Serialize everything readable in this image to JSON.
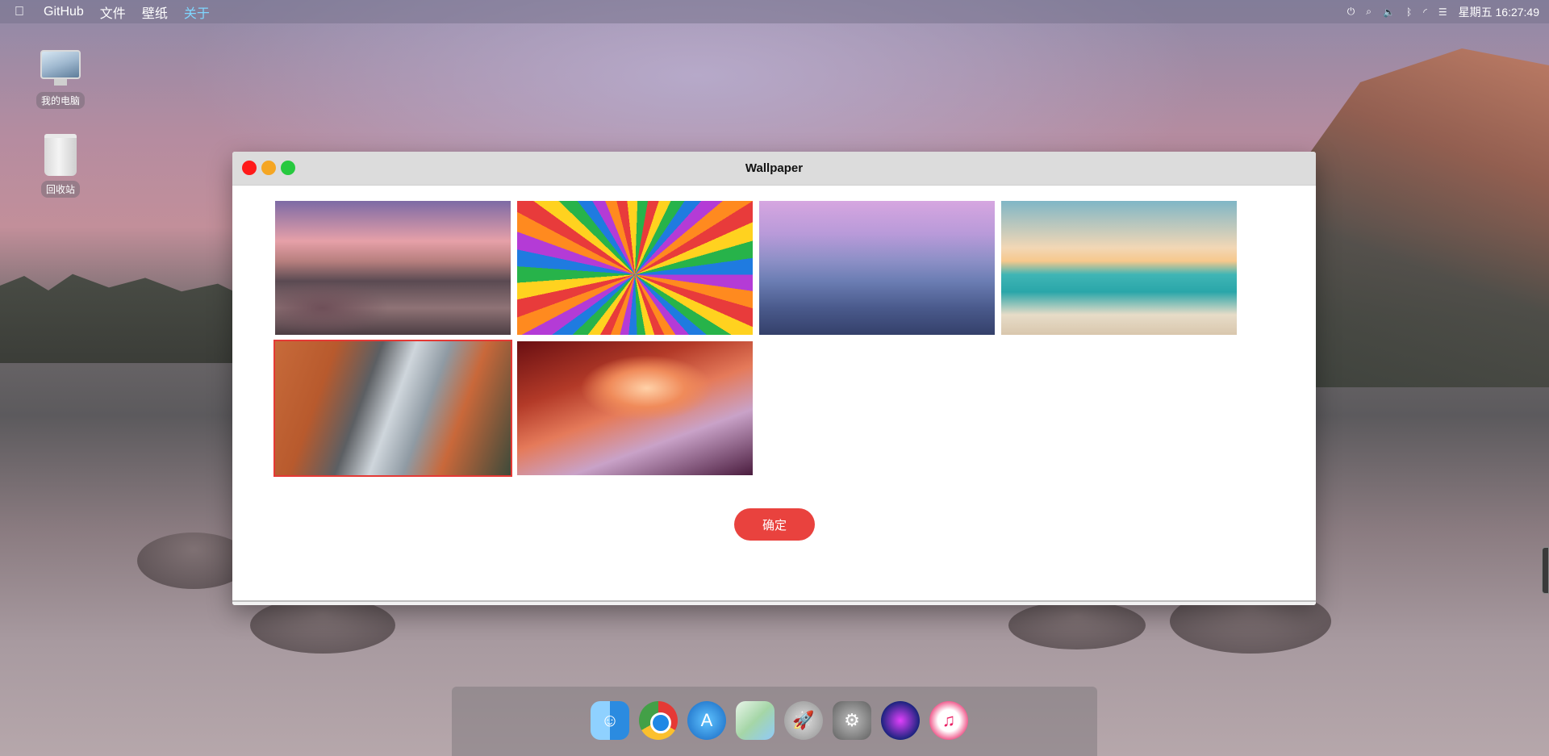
{
  "menubar": {
    "apple_icon": "apple-icon",
    "items": [
      {
        "label": "GitHub"
      },
      {
        "label": "文件"
      },
      {
        "label": "壁纸"
      },
      {
        "label": "关于"
      }
    ],
    "status_icons": [
      "power-icon",
      "search-icon",
      "volume-icon",
      "bluetooth-icon",
      "wifi-icon",
      "list-icon"
    ],
    "clock": "星期五 16:27:49"
  },
  "desktop": {
    "icons": [
      {
        "label": "我的电脑",
        "icon": "computer-icon"
      },
      {
        "label": "回收站",
        "icon": "trash-icon"
      }
    ]
  },
  "window": {
    "title": "Wallpaper",
    "confirm_label": "确定",
    "selected_index": 4,
    "wallpapers": [
      {
        "name": "lake-mountains"
      },
      {
        "name": "color-burst"
      },
      {
        "name": "half-dome"
      },
      {
        "name": "beach-sunset"
      },
      {
        "name": "el-capitan"
      },
      {
        "name": "antelope-canyon"
      }
    ]
  },
  "dock": {
    "apps": [
      "finder-icon",
      "chrome-icon",
      "app-store-icon",
      "maps-icon",
      "launchpad-icon",
      "system-preferences-icon",
      "siri-icon",
      "itunes-icon"
    ]
  }
}
